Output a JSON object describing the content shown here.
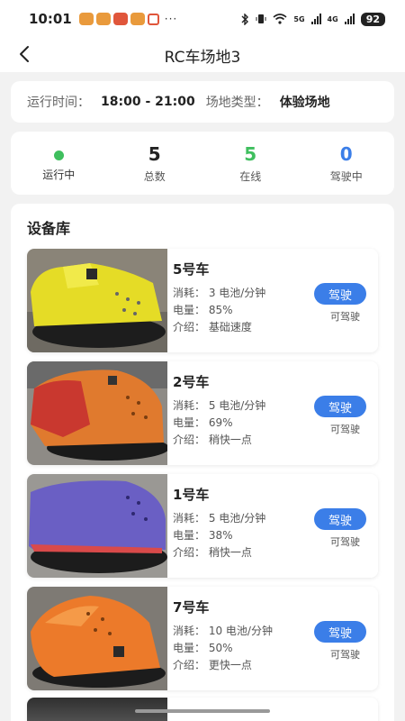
{
  "status_bar": {
    "time": "10:01",
    "dots": "···",
    "network_5g": "5G",
    "network_4g": "4G",
    "battery": "92"
  },
  "nav": {
    "title": "RC车场地3"
  },
  "info": {
    "time_label": "运行时间：",
    "time_value": "18:00 - 21:00",
    "type_label": "场地类型：",
    "type_value": "体验场地"
  },
  "stats": {
    "status_label": "运行中",
    "status_color": "#3fbf5e",
    "total": {
      "value": "5",
      "label": "总数"
    },
    "online": {
      "value": "5",
      "label": "在线",
      "color": "#3fbf5e"
    },
    "driving": {
      "value": "0",
      "label": "驾驶中",
      "color": "#3b7ee8"
    }
  },
  "library": {
    "title": "设备库",
    "devices": [
      {
        "name": "5号车",
        "consumption": "消耗：  3 电池/分钟",
        "battery": "电量：  85%",
        "intro": "介绍：  基础速度",
        "button": "驾驶",
        "status": "可驾驶",
        "color": "yellow"
      },
      {
        "name": "2号车",
        "consumption": "消耗：  5 电池/分钟",
        "battery": "电量：  69%",
        "intro": "介绍：  稍快一点",
        "button": "驾驶",
        "status": "可驾驶",
        "color": "orange-red"
      },
      {
        "name": "1号车",
        "consumption": "消耗：  5 电池/分钟",
        "battery": "电量：  38%",
        "intro": "介绍：  稍快一点",
        "button": "驾驶",
        "status": "可驾驶",
        "color": "purple"
      },
      {
        "name": "7号车",
        "consumption": "消耗：  10 电池/分钟",
        "battery": "电量：  50%",
        "intro": "介绍：  更快一点",
        "button": "驾驶",
        "status": "可驾驶",
        "color": "orange"
      }
    ]
  },
  "colors": {
    "accent": "#3b7ee8",
    "online_green": "#3fbf5e"
  }
}
